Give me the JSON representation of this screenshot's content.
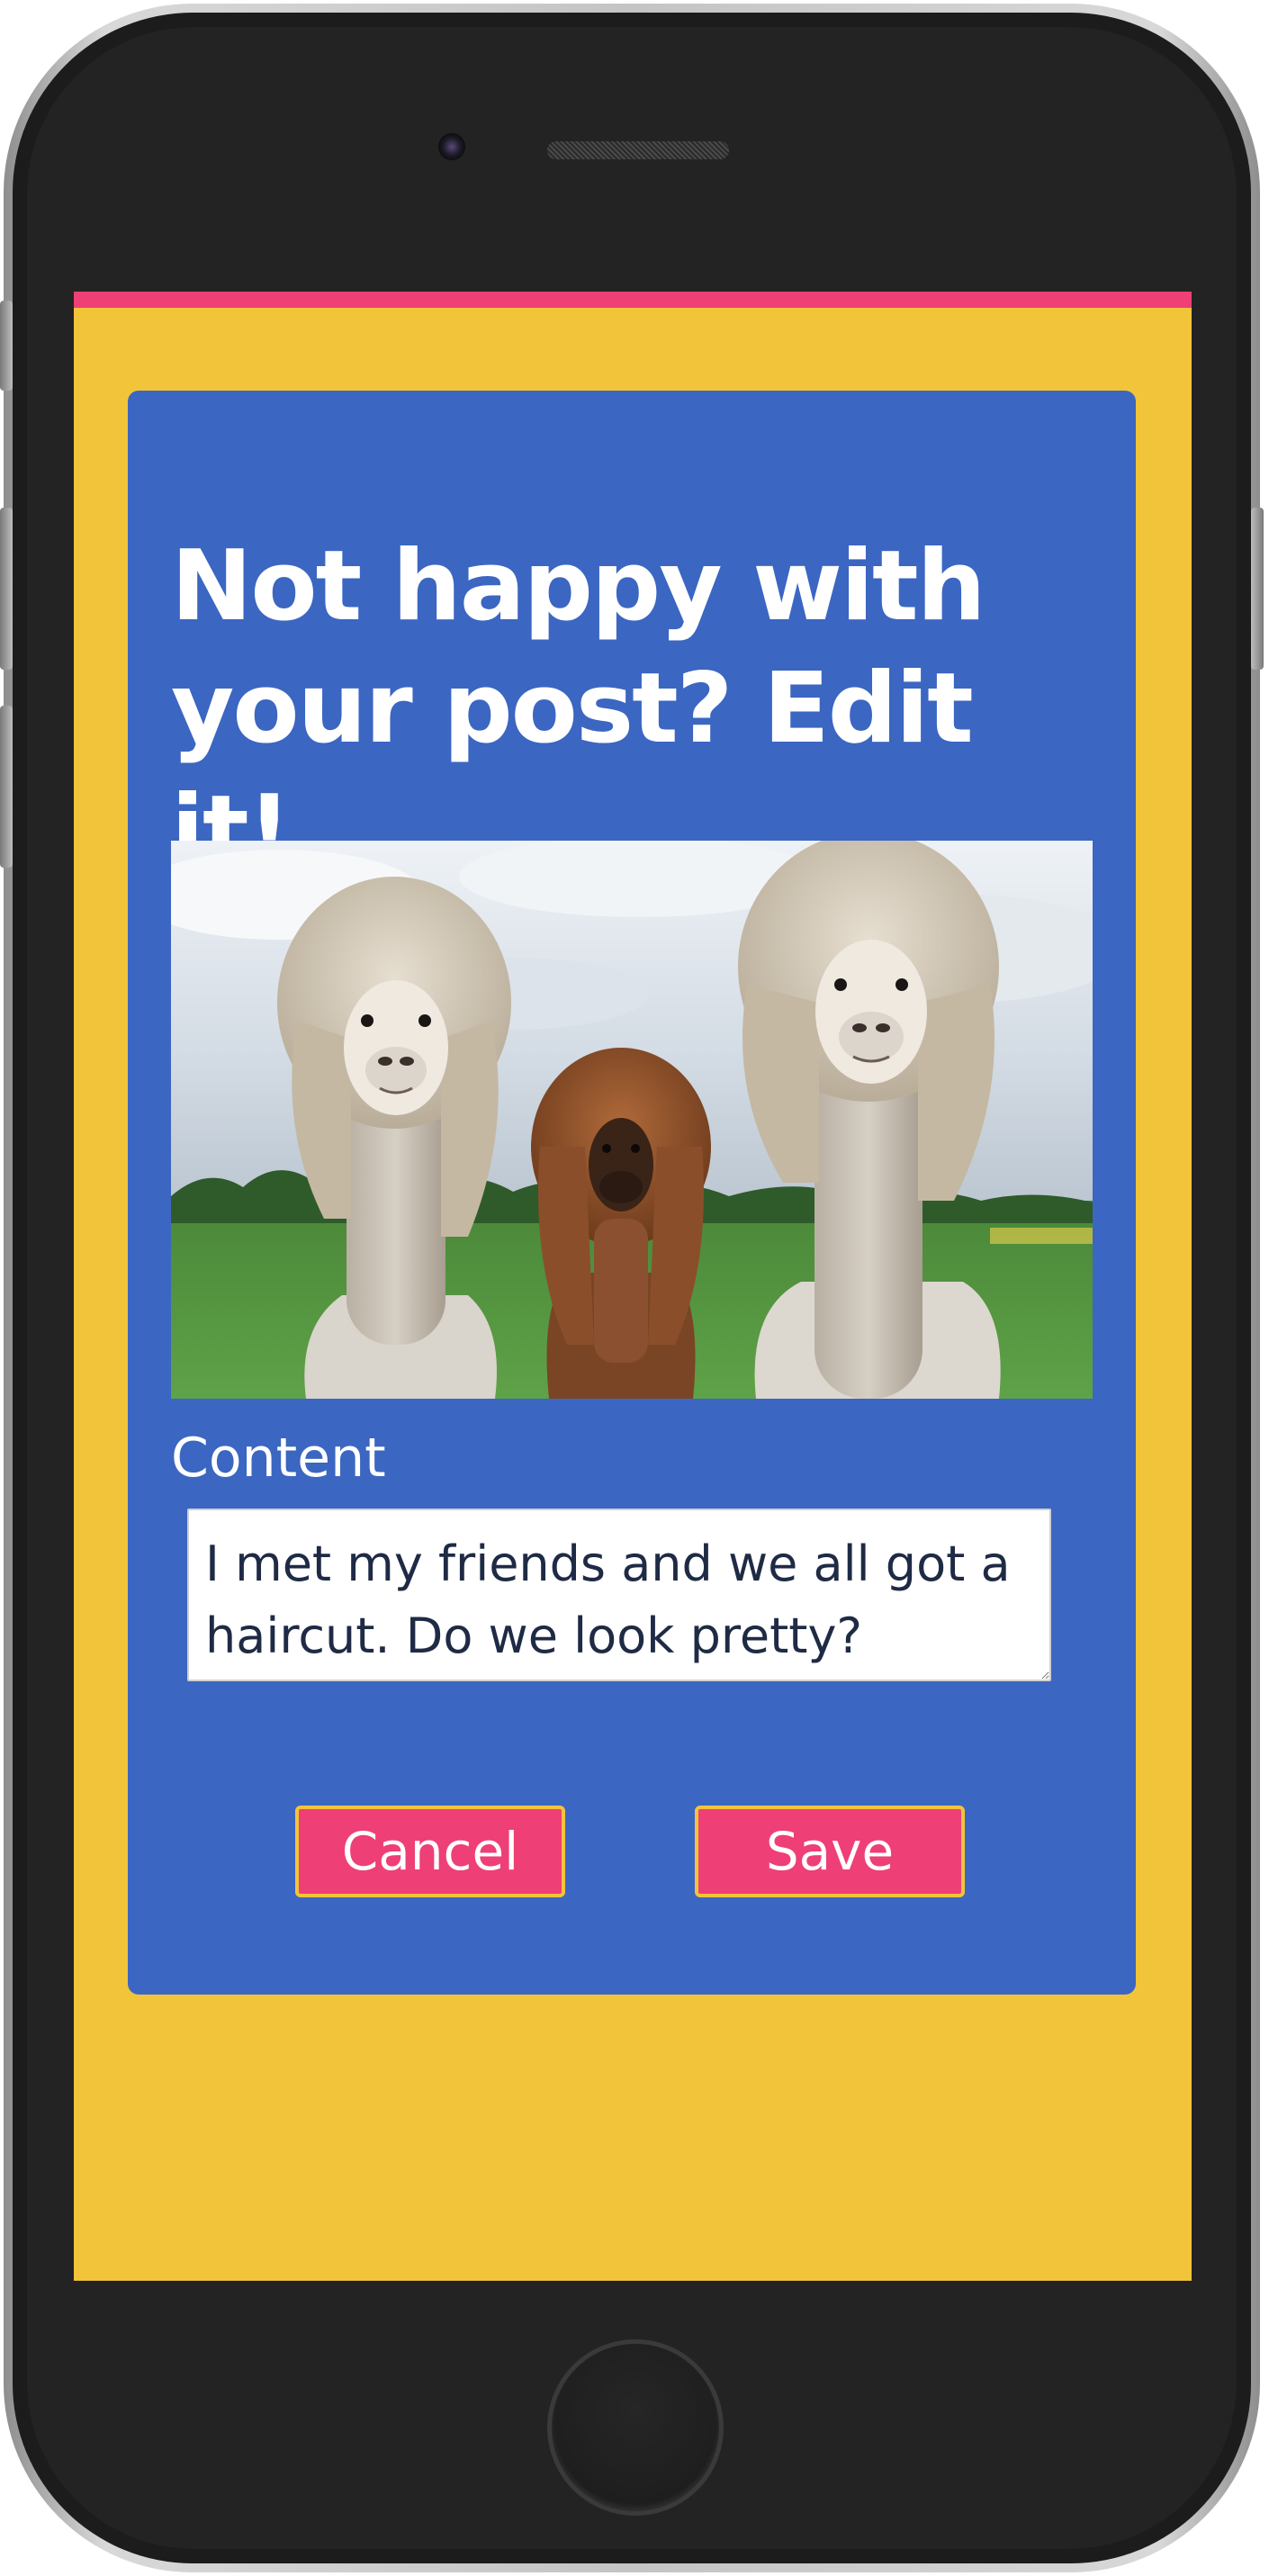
{
  "post_editor": {
    "title": "Not happy with your post? Edit it!",
    "image": {
      "subject": "three-alpacas-with-haircuts"
    },
    "content_label": "Content",
    "content_value": "I met my friends and we all got a haircut. Do we look pretty?",
    "cancel_label": "Cancel",
    "save_label": "Save"
  },
  "colors": {
    "background": "#f2c43a",
    "top_stripe": "#ee3f76",
    "card": "#3b66c2",
    "button": "#ee3f76",
    "button_border": "#f2c43a",
    "text_light": "#ffffff",
    "text_dark": "#1f2b45"
  }
}
